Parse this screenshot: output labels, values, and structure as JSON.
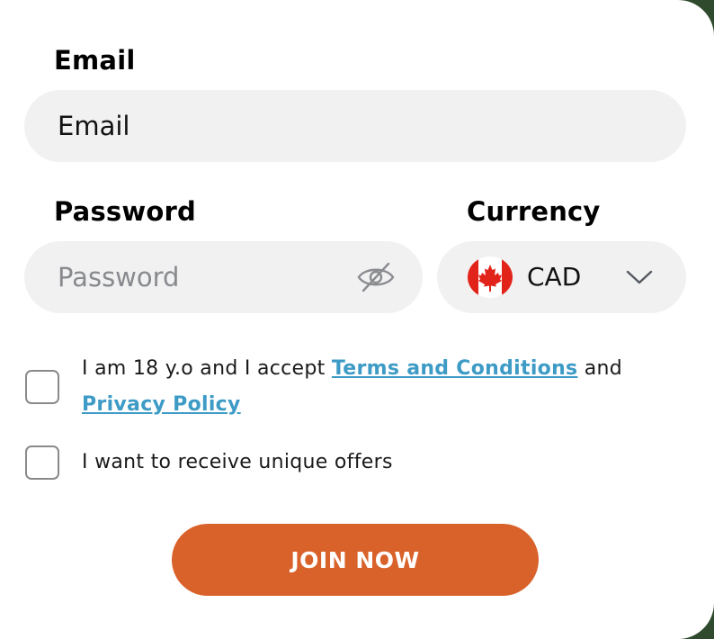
{
  "email": {
    "label": "Email",
    "placeholder": "Email",
    "value": ""
  },
  "password": {
    "label": "Password",
    "placeholder": "Password",
    "value": "",
    "toggle_icon": "eye-slash-icon"
  },
  "currency": {
    "label": "Currency",
    "selected": "CAD",
    "flag_icon": "canada-flag-icon",
    "dropdown_icon": "chevron-down-icon"
  },
  "consent": {
    "prefix": "I am 18 y.o and I accept ",
    "terms_link": "Terms and Conditions",
    "middle": " and",
    "privacy_link": "Privacy Policy",
    "checked": false
  },
  "offers": {
    "text": "I want to receive unique offers",
    "checked": false
  },
  "join_button": "JOIN NOW",
  "colors": {
    "accent": "#d9622b",
    "link": "#3d9bc6",
    "field_background": "#f1f1f2"
  }
}
